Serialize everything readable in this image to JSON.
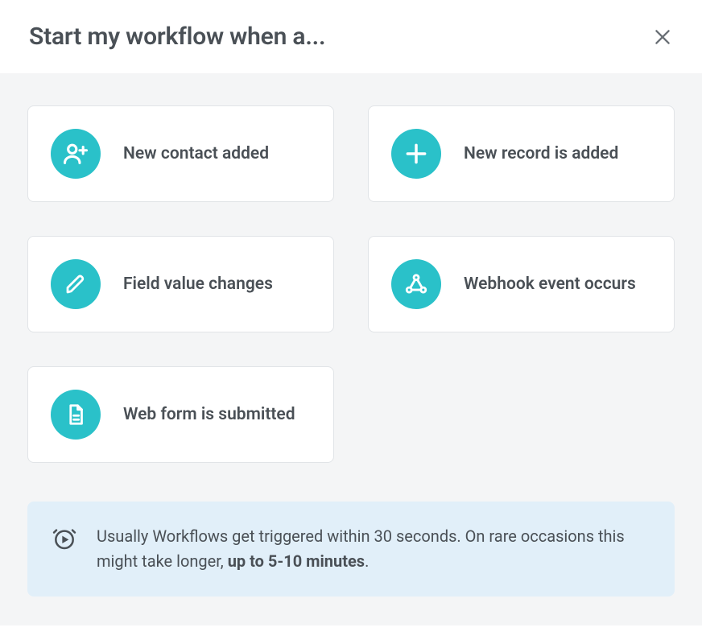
{
  "header": {
    "title": "Start my workflow when a..."
  },
  "triggers": [
    {
      "icon": "person-plus-icon",
      "label": "New contact added"
    },
    {
      "icon": "plus-icon",
      "label": "New record is added"
    },
    {
      "icon": "pencil-icon",
      "label": "Field value changes"
    },
    {
      "icon": "webhook-icon",
      "label": "Webhook event occurs"
    },
    {
      "icon": "document-icon",
      "label": "Web form is submitted"
    }
  ],
  "info": {
    "text_lead": "Usually Workflows get triggered within 30 seconds. On rare occasions this might take longer, ",
    "text_bold": "up to 5-10 minutes",
    "text_tail": "."
  },
  "colors": {
    "accent": "#2ac1c9",
    "banner_bg": "#e1eff9",
    "text": "#4a5056",
    "body_bg": "#f4f5f6",
    "card_border": "#e1e4e7"
  }
}
